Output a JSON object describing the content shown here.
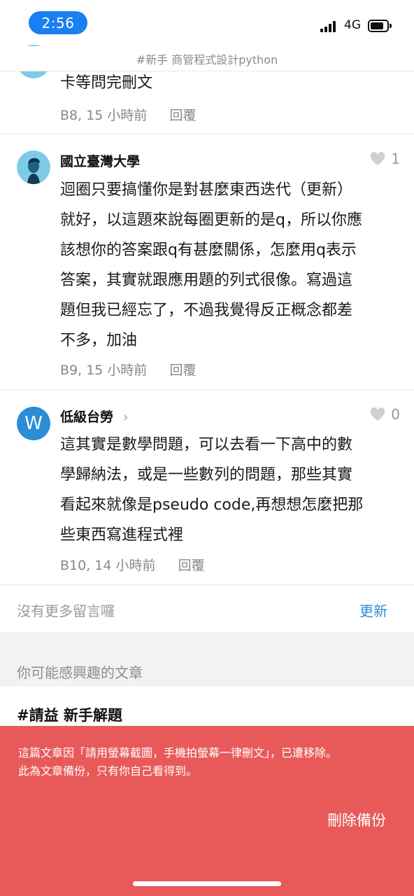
{
  "status_bar": {
    "time": "2:56",
    "network": "4G"
  },
  "header": {
    "title": "#新手 商管程式設計python"
  },
  "comments": [
    {
      "body_lines": [
        "卡等問完刪文"
      ],
      "floor_time": "B8, 15 小時前",
      "reply_label": "回覆"
    },
    {
      "author": "國立臺灣大學",
      "likes": "1",
      "body_lines": [
        "迴圈只要搞懂你是對甚麼東西迭代（更新）",
        "就好，以這題來說每圈更新的是q，所以你應",
        "該想你的答案跟q有甚麼關係，怎麼用q表示",
        "答案，其實就跟應用題的列式很像。寫過這",
        "題但我已經忘了，不過我覺得反正概念都差",
        "不多，加油"
      ],
      "floor_time": "B9, 15 小時前",
      "reply_label": "回覆"
    },
    {
      "author": "低級台勞",
      "author_chevron": "›",
      "avatar_letter": "W",
      "likes": "0",
      "body_lines": [
        "這其實是數學問題，可以去看一下高中的數",
        "學歸納法，或是一些數列的問題，那些其實",
        "看起來就像是pseudo code,再想想怎麼把那",
        "些東西寫進程式裡"
      ],
      "floor_time": "B10, 14 小時前",
      "reply_label": "回覆"
    }
  ],
  "footer": {
    "no_more": "沒有更多留言囉",
    "refresh": "更新"
  },
  "related": {
    "section_title": "你可能感興趣的文章",
    "article_title": "#請益 新手解題"
  },
  "banner": {
    "line1": "這篇文章因「請用螢幕截圖，手機拍螢幕一律刪文」，已遭移除。",
    "line2": "此為文章備份，只有你自己看得到。",
    "delete_label": "刪除備份"
  },
  "colors": {
    "accent": "#2a8dd6",
    "banner": "#e85a5a",
    "time_pill": "#1a7ff0"
  },
  "icons": [
    "signal-icon",
    "battery-icon",
    "heart-icon",
    "chevron-right-icon",
    "avatar-icon"
  ]
}
